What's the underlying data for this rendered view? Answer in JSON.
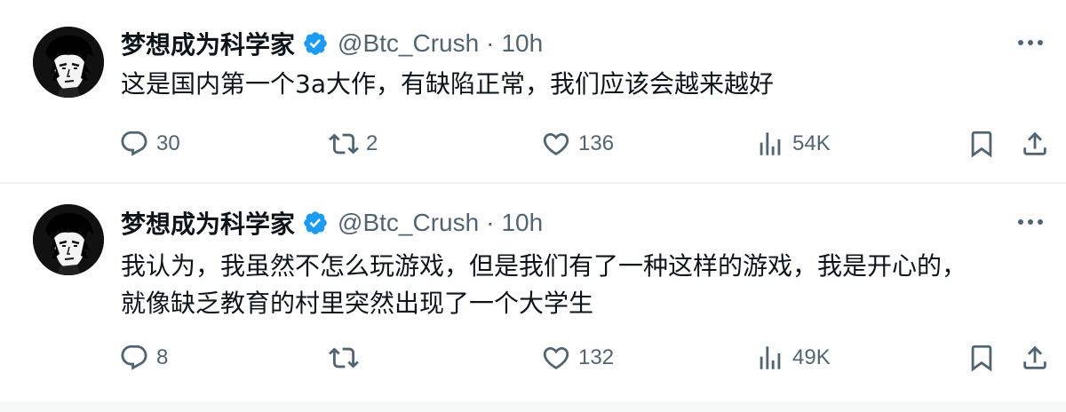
{
  "tweets": [
    {
      "display_name": "梦想成为科学家",
      "handle": "@Btc_Crush",
      "separator": "·",
      "time": "10h",
      "text_lines": [
        "这是国内第一个3a大作，有缺陷正常，我们应该会越来越好"
      ],
      "replies": "30",
      "retweets": "2",
      "likes": "136",
      "views": "54K"
    },
    {
      "display_name": "梦想成为科学家",
      "handle": "@Btc_Crush",
      "separator": "·",
      "time": "10h",
      "text_lines": [
        "我认为，我虽然不怎么玩游戏，但是我们有了一种这样的游戏，我是开心的，",
        "就像缺乏教育的村里突然出现了一个大学生"
      ],
      "replies": "8",
      "retweets": "",
      "likes": "132",
      "views": "49K"
    }
  ],
  "icons": {
    "avatar": "anime-portrait-avatar",
    "verified": "verified-badge-icon",
    "more": "more-options-icon",
    "reply": "reply-icon",
    "retweet": "retweet-icon",
    "like": "like-heart-icon",
    "views": "views-chart-icon",
    "bookmark": "bookmark-icon",
    "share": "share-icon"
  },
  "colors": {
    "verified": "#1d9bf0",
    "secondary_text": "#536471",
    "primary_text": "#0f1419",
    "divider": "#eff3f4"
  }
}
